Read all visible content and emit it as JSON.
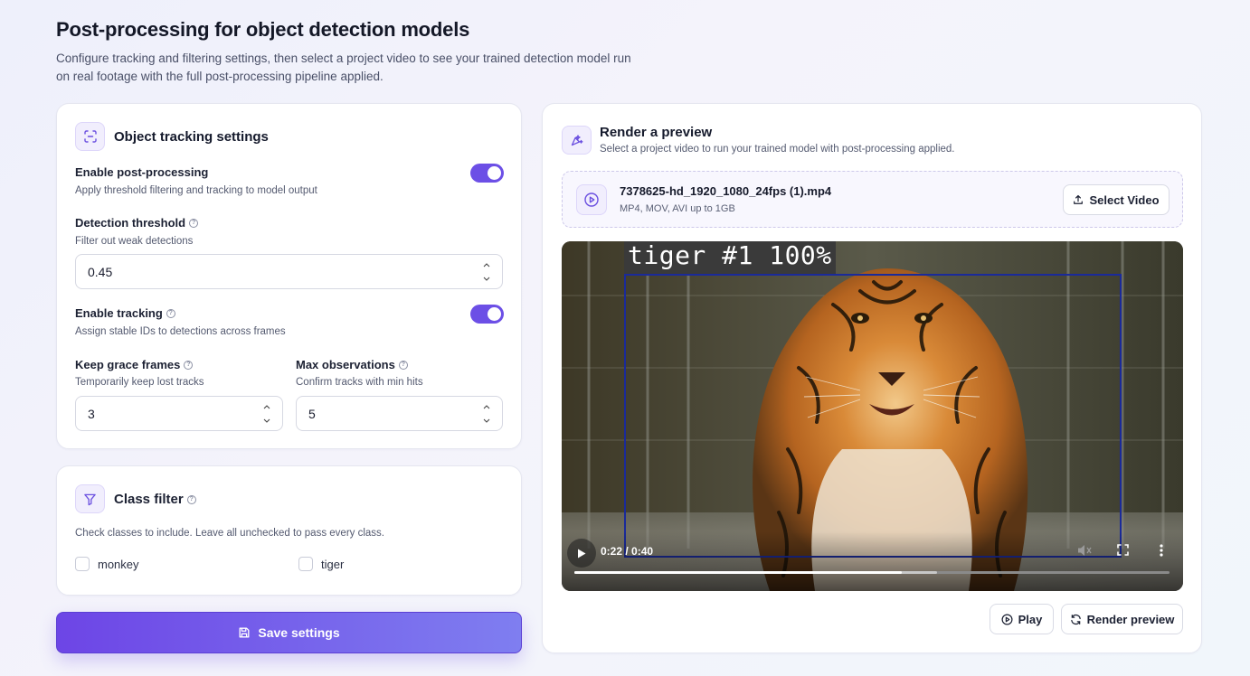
{
  "header": {
    "title": "Post-processing for object detection models",
    "subtitle": "Configure tracking and filtering settings, then select a project video to see your trained detection model run on real footage with the full post-processing pipeline applied."
  },
  "tracking": {
    "title": "Object tracking settings",
    "enable_post": {
      "label": "Enable post-processing",
      "hint": "Apply threshold filtering and tracking to model output",
      "on": true
    },
    "threshold": {
      "label": "Detection threshold",
      "hint": "Filter out weak detections",
      "value": "0.45"
    },
    "enable_tracking": {
      "label": "Enable tracking",
      "hint": "Assign stable IDs to detections across frames",
      "on": true
    },
    "grace": {
      "label": "Keep grace frames",
      "hint": "Temporarily keep lost tracks",
      "value": "3"
    },
    "max_obs": {
      "label": "Max observations",
      "hint": "Confirm tracks with min hits",
      "value": "5"
    }
  },
  "filter": {
    "title": "Class filter",
    "hint": "Check classes to include. Leave all unchecked to pass every class.",
    "classes": [
      {
        "label": "monkey",
        "checked": false
      },
      {
        "label": "tiger",
        "checked": false
      }
    ]
  },
  "save_label": "Save settings",
  "preview": {
    "title": "Render a preview",
    "subtitle": "Select a project video to run your trained model with post-processing applied.",
    "file_name": "7378625-hd_1920_1080_24fps (1).mp4",
    "file_meta": "MP4, MOV, AVI up to 1GB",
    "select_label": "Select Video",
    "detection_label": "tiger #1 100%",
    "time": "0:22 / 0:40",
    "progress_fraction": 0.55,
    "buffered_fraction": 0.61,
    "play_label": "Play",
    "render_label": "Render preview"
  },
  "colors": {
    "accent": "#6c4fe6",
    "detection_box": "#1a2a9a"
  }
}
